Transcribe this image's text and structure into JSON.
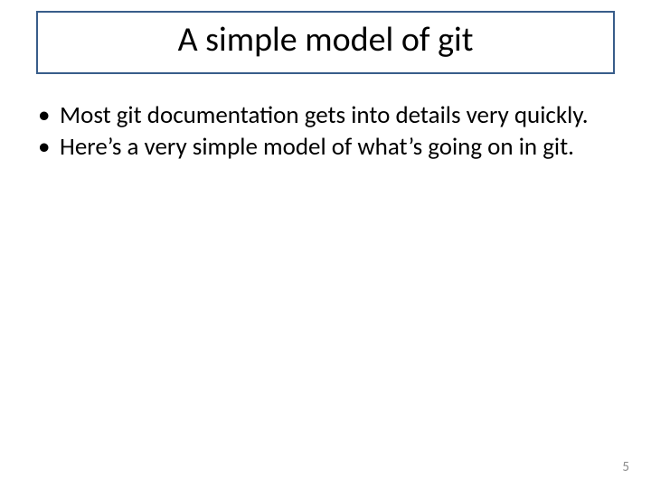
{
  "slide": {
    "title": "A simple model of git",
    "bullets": [
      "Most git documentation gets into details very quickly.",
      "Here’s a very simple model of what’s going on in git."
    ],
    "page_number": "5"
  }
}
